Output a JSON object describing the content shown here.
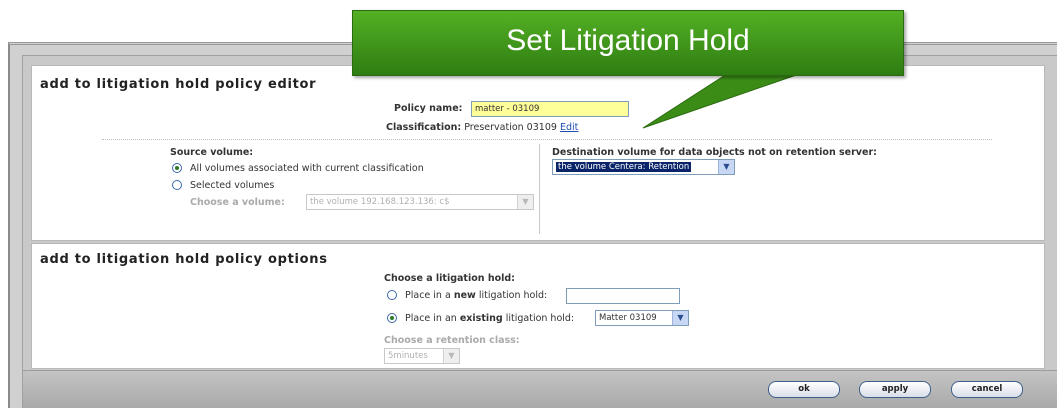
{
  "callout": {
    "text": "Set Litigation Hold"
  },
  "editor": {
    "title": "add to litigation hold policy editor",
    "policy_name_label": "Policy name:",
    "policy_name_value": "matter - 03109",
    "classification_label": "Classification:",
    "classification_value": "Preservation 03109",
    "edit_link": "Edit",
    "source_volume_label": "Source volume:",
    "radio_all": "All volumes associated with current classification",
    "radio_selected": "Selected volumes",
    "choose_volume_label": "Choose a volume:",
    "choose_volume_value": "the volume 192.168.123.136: c$",
    "destination_label": "Destination volume for data objects not on retention server:",
    "destination_value": "the volume Centera: Retention"
  },
  "options": {
    "title": "add to litigation hold policy options",
    "choose_hold_label": "Choose a litigation hold:",
    "new_prefix": "Place in a",
    "new_bold": "new",
    "new_suffix": "litigation hold:",
    "existing_prefix": "Place in an",
    "existing_bold": "existing",
    "existing_suffix": "litigation hold:",
    "existing_value": "Matter 03109",
    "retention_label": "Choose a retention class:",
    "retention_value": "5minutes"
  },
  "buttons": {
    "ok": "ok",
    "apply": "apply",
    "cancel": "cancel"
  },
  "colors": {
    "callout_green": "#3f9a1a",
    "highlight_yellow": "#ffff99",
    "selection_blue": "#0a246a"
  }
}
